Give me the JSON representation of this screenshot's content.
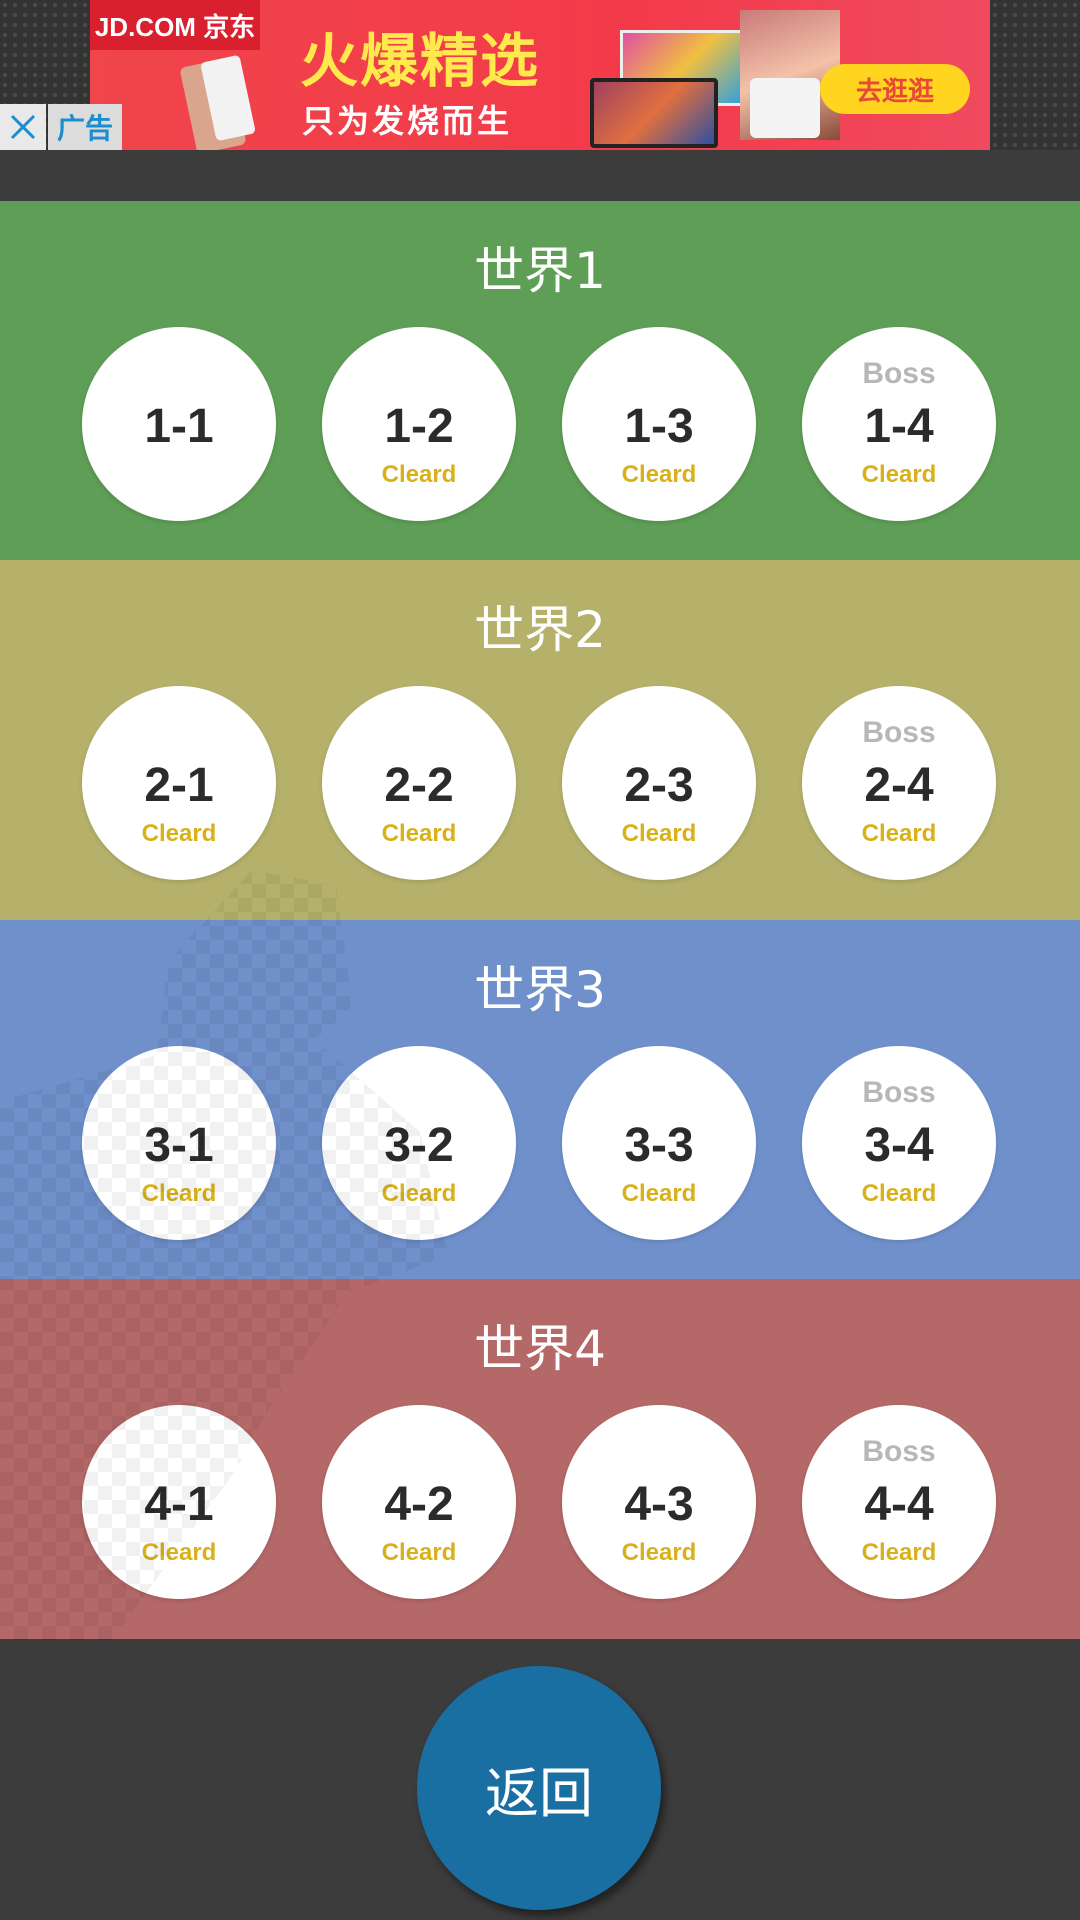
{
  "ad": {
    "brand": "JD.COM 京东",
    "headline": "火爆精选",
    "subline": "只为发烧而生",
    "cta": "去逛逛",
    "label": "广告",
    "close_icon": "close-icon"
  },
  "worlds": [
    {
      "title": "世界1",
      "color": "#5e9e56",
      "levels": [
        {
          "num": "1-1",
          "status": "",
          "boss": ""
        },
        {
          "num": "1-2",
          "status": "Cleard",
          "boss": ""
        },
        {
          "num": "1-3",
          "status": "Cleard",
          "boss": ""
        },
        {
          "num": "1-4",
          "status": "Cleard",
          "boss": "Boss"
        }
      ]
    },
    {
      "title": "世界2",
      "color": "#b5b16b",
      "levels": [
        {
          "num": "2-1",
          "status": "Cleard",
          "boss": ""
        },
        {
          "num": "2-2",
          "status": "Cleard",
          "boss": ""
        },
        {
          "num": "2-3",
          "status": "Cleard",
          "boss": ""
        },
        {
          "num": "2-4",
          "status": "Cleard",
          "boss": "Boss"
        }
      ]
    },
    {
      "title": "世界3",
      "color": "#7090cc",
      "levels": [
        {
          "num": "3-1",
          "status": "Cleard",
          "boss": ""
        },
        {
          "num": "3-2",
          "status": "Cleard",
          "boss": ""
        },
        {
          "num": "3-3",
          "status": "Cleard",
          "boss": ""
        },
        {
          "num": "3-4",
          "status": "Cleard",
          "boss": "Boss"
        }
      ]
    },
    {
      "title": "世界4",
      "color": "#b46868",
      "levels": [
        {
          "num": "4-1",
          "status": "Cleard",
          "boss": ""
        },
        {
          "num": "4-2",
          "status": "Cleard",
          "boss": ""
        },
        {
          "num": "4-3",
          "status": "Cleard",
          "boss": ""
        },
        {
          "num": "4-4",
          "status": "Cleard",
          "boss": "Boss"
        }
      ]
    }
  ],
  "back_button": {
    "label": "返回"
  }
}
